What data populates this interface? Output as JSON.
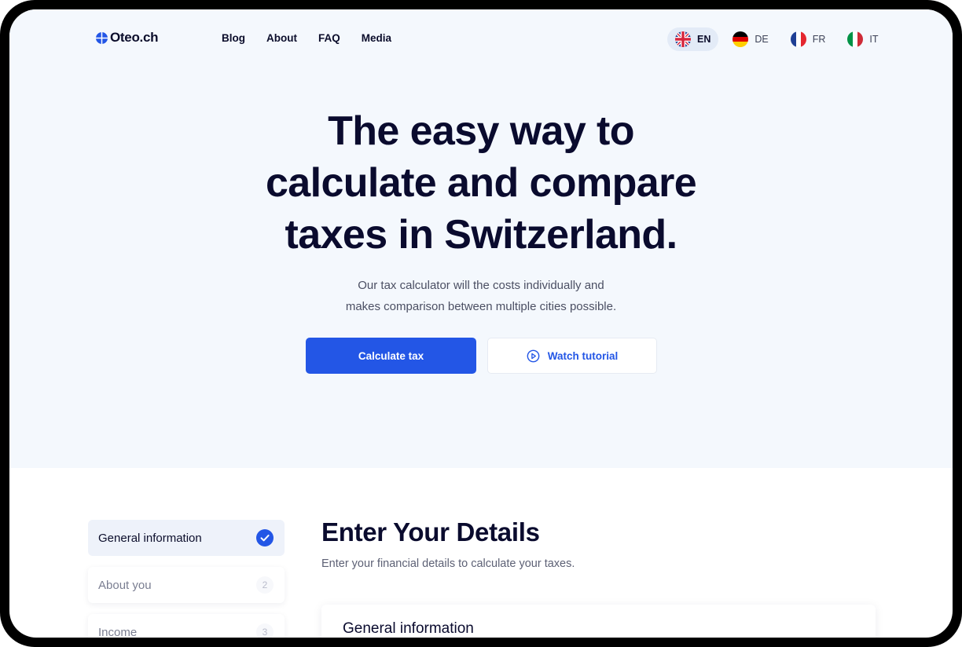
{
  "brand": {
    "name": "Oteo.ch",
    "icon": "logo-mark"
  },
  "nav": {
    "links": [
      {
        "label": "Blog"
      },
      {
        "label": "About"
      },
      {
        "label": "FAQ"
      },
      {
        "label": "Media"
      }
    ]
  },
  "languages": [
    {
      "code": "EN",
      "flag": "uk-flag-icon",
      "active": true
    },
    {
      "code": "DE",
      "flag": "germany-flag-icon",
      "active": false
    },
    {
      "code": "FR",
      "flag": "france-flag-icon",
      "active": false
    },
    {
      "code": "IT",
      "flag": "italy-flag-icon",
      "active": false
    }
  ],
  "hero": {
    "title_lines": [
      "The easy way to",
      "calculate and compare",
      "taxes in Switzerland."
    ],
    "subtitle_lines": [
      "Our tax calculator will the costs individually and",
      "makes comparison  between multiple cities possible."
    ],
    "primary_cta": "Calculate tax",
    "secondary_cta": "Watch tutorial"
  },
  "steps": [
    {
      "label": "General information",
      "status": "done"
    },
    {
      "label": "About you",
      "number": "2"
    },
    {
      "label": "Income",
      "number": "3"
    }
  ],
  "details": {
    "title": "Enter Your Details",
    "description": "Enter your financial details to calculate your taxes.",
    "card_title": "General information"
  },
  "colors": {
    "accent": "#2356e6",
    "hero_bg": "#f4f8fd",
    "text_dark": "#0a0b2e"
  }
}
